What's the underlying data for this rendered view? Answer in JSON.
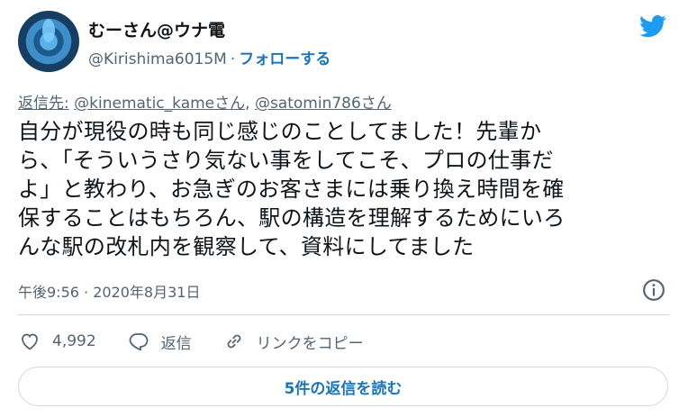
{
  "author": {
    "display_name": "むーさん@ウナ電",
    "handle": "@Kirishima6015M",
    "separator": "·",
    "follow_label": "フォローする"
  },
  "reply_to": {
    "label": "返信先:",
    "mention_1": "@kinematic_kameさん",
    "separator": ",",
    "mention_2": "@satomin786さん"
  },
  "tweet": {
    "line_1": "自分が現役の時も同じ感じのことしてました！先輩か",
    "line_2": "ら、「そういうさり気ない事をしてこそ、プロの仕事だ",
    "line_3": "よ」と教わり、お急ぎのお客さまには乗り換え時間を確",
    "line_4": "保することはもちろん、駅の構造を理解するためにいろ",
    "line_5": "んな駅の改札内を観察して、資料にしてました",
    "timestamp": "午後9:56 · 2020年8月31日"
  },
  "actions": {
    "like_count": "4,992",
    "reply_label": "返信",
    "copy_link_label": "リンクをコピー"
  },
  "read_replies_label": "5件の返信を読む",
  "icons": {
    "brand": "twitter-bird-icon",
    "info": "info-icon",
    "like": "heart-icon",
    "reply": "speech-bubble-icon",
    "link": "link-icon"
  },
  "colors": {
    "brand_blue": "#1d9bf0",
    "link_blue": "#1b75bc",
    "text": "#0f1419",
    "muted": "#536471",
    "border": "#cfd9de"
  }
}
